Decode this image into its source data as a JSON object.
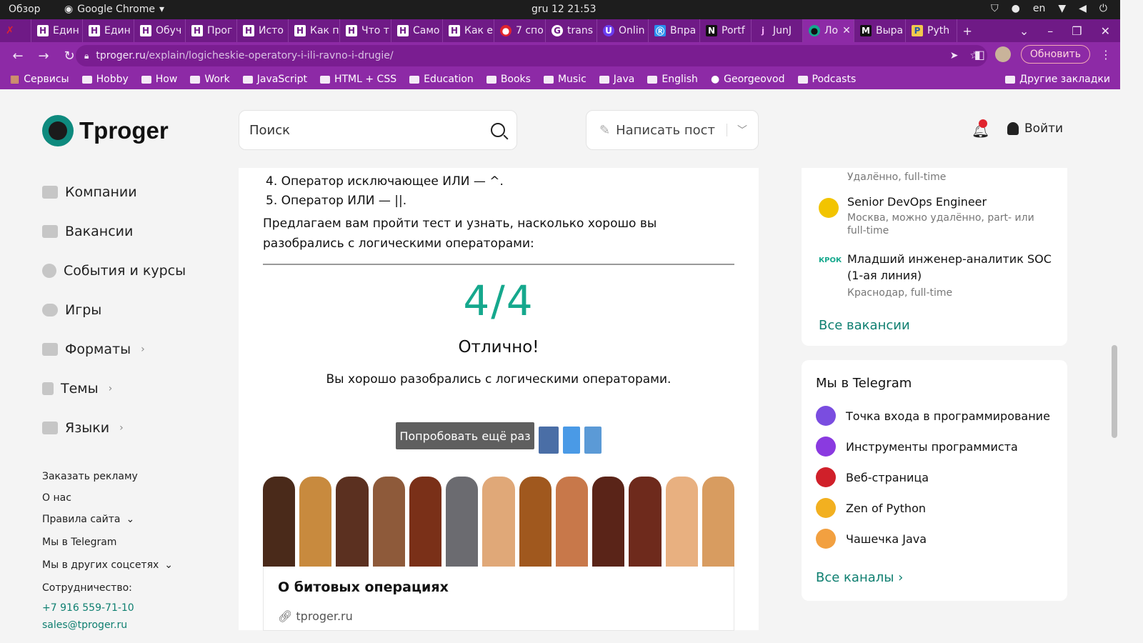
{
  "system": {
    "overview": "Обзор",
    "app_name": "Google Chrome",
    "clock": "gru 12  21:53",
    "lang": "en"
  },
  "tabs": [
    {
      "label": "Един",
      "favicon": "Н"
    },
    {
      "label": "Един",
      "favicon": "Н"
    },
    {
      "label": "Обуч",
      "favicon": "Н"
    },
    {
      "label": "Прог",
      "favicon": "Н"
    },
    {
      "label": "Исто",
      "favicon": "Н"
    },
    {
      "label": "Как п",
      "favicon": "Н"
    },
    {
      "label": "Что т",
      "favicon": "Н"
    },
    {
      "label": "Само",
      "favicon": "Н"
    },
    {
      "label": "Как е",
      "favicon": "Н"
    },
    {
      "label": "7 спо",
      "favicon": "●"
    },
    {
      "label": "trans",
      "favicon": "G"
    },
    {
      "label": "Onlin",
      "favicon": "U"
    },
    {
      "label": "Впра",
      "favicon": "Ⓡ"
    },
    {
      "label": "Portf",
      "favicon": "N"
    },
    {
      "label": "JunJ",
      "favicon": "j"
    },
    {
      "label": "Ло",
      "favicon": "●"
    },
    {
      "label": "Выра",
      "favicon": "M"
    },
    {
      "label": "Pyth",
      "favicon": "P"
    }
  ],
  "omnibox": {
    "host": "tproger.ru",
    "path": "/explain/logicheskie-operatory-i-ili-ravno-i-drugie/",
    "update_label": "Обновить"
  },
  "bookmarks": [
    "Сервисы",
    "Hobby",
    "How",
    "Work",
    "JavaScript",
    "HTML + CSS",
    "Education",
    "Books",
    "Music",
    "Java",
    "English",
    "Georgeovod",
    "Podcasts"
  ],
  "bookmarks_other": "Другие закладки",
  "site": {
    "logo": "Tproger",
    "search_placeholder": "Поиск",
    "write_post": "Написать пост",
    "login": "Войти"
  },
  "sidebar": [
    {
      "label": "Компании",
      "arrow": ""
    },
    {
      "label": "Вакансии",
      "arrow": ""
    },
    {
      "label": "События и курсы",
      "arrow": ""
    },
    {
      "label": "Игры",
      "arrow": ""
    },
    {
      "label": "Форматы",
      "arrow": "›"
    },
    {
      "label": "Темы",
      "arrow": "›"
    },
    {
      "label": "Языки",
      "arrow": "›"
    }
  ],
  "footer_links": {
    "ads": "Заказать рекламу",
    "about": "О нас",
    "rules": "Правила сайта",
    "telegram": "Мы в Telegram",
    "socials": "Мы в других соцсетях",
    "coop": "Сотрудничество:",
    "phone": "+7 916 559-71-10",
    "email": "sales@tproger.ru"
  },
  "article": {
    "list_item_4": "4. Оператор исключающее ИЛИ — ^.",
    "list_item_5": "5. Оператор ИЛИ — ||.",
    "intro": "Предлагаем вам пройти тест и узнать, насколько хорошо вы разобрались с логическими операторами:",
    "score": "4/4",
    "verdict": "Отлично!",
    "description": "Вы хорошо разобрались с логическими операторами.",
    "retry": "Попробовать ещё раз",
    "card_title": "О битовых операциях",
    "card_url": "tproger.ru"
  },
  "jobs": [
    {
      "title": "",
      "meta": "Удалённо, full-time"
    },
    {
      "title": "Senior DevOps Engineer",
      "meta": "Москва, можно удалённо, part- или full-time"
    },
    {
      "title": "Младший инженер-аналитик SOC (1-ая линия)",
      "meta": "Краснодар, full-time",
      "logo_text": "КРОК"
    }
  ],
  "jobs_all": "Все вакансии",
  "telegram": {
    "title": "Мы в Telegram",
    "channels": [
      "Точка входа в программирование",
      "Инструменты программиста",
      "Веб-страница",
      "Zen of Python",
      "Чашечка Java"
    ],
    "all": "Все каналы ›"
  },
  "colors": {
    "accent": "#15a88d",
    "chrome_purple": "#8d2aa6",
    "link_green": "#0e7f70"
  }
}
